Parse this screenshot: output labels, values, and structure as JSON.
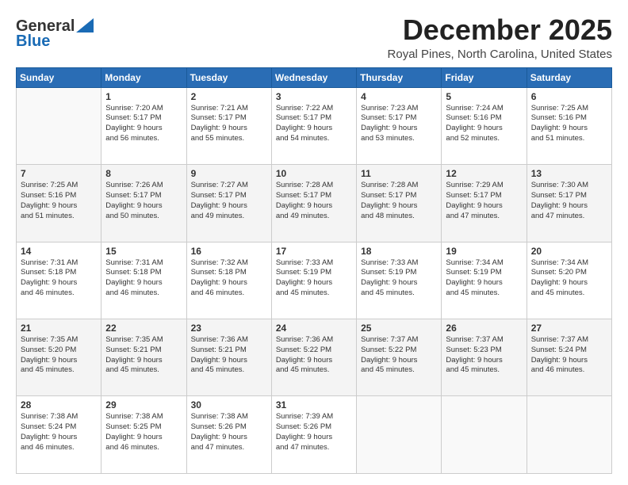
{
  "header": {
    "logo_general": "General",
    "logo_blue": "Blue",
    "month_year": "December 2025",
    "location": "Royal Pines, North Carolina, United States"
  },
  "days_of_week": [
    "Sunday",
    "Monday",
    "Tuesday",
    "Wednesday",
    "Thursday",
    "Friday",
    "Saturday"
  ],
  "weeks": [
    [
      {
        "day": "",
        "info": ""
      },
      {
        "day": "1",
        "info": "Sunrise: 7:20 AM\nSunset: 5:17 PM\nDaylight: 9 hours\nand 56 minutes."
      },
      {
        "day": "2",
        "info": "Sunrise: 7:21 AM\nSunset: 5:17 PM\nDaylight: 9 hours\nand 55 minutes."
      },
      {
        "day": "3",
        "info": "Sunrise: 7:22 AM\nSunset: 5:17 PM\nDaylight: 9 hours\nand 54 minutes."
      },
      {
        "day": "4",
        "info": "Sunrise: 7:23 AM\nSunset: 5:17 PM\nDaylight: 9 hours\nand 53 minutes."
      },
      {
        "day": "5",
        "info": "Sunrise: 7:24 AM\nSunset: 5:16 PM\nDaylight: 9 hours\nand 52 minutes."
      },
      {
        "day": "6",
        "info": "Sunrise: 7:25 AM\nSunset: 5:16 PM\nDaylight: 9 hours\nand 51 minutes."
      }
    ],
    [
      {
        "day": "7",
        "info": "Sunrise: 7:25 AM\nSunset: 5:16 PM\nDaylight: 9 hours\nand 51 minutes."
      },
      {
        "day": "8",
        "info": "Sunrise: 7:26 AM\nSunset: 5:17 PM\nDaylight: 9 hours\nand 50 minutes."
      },
      {
        "day": "9",
        "info": "Sunrise: 7:27 AM\nSunset: 5:17 PM\nDaylight: 9 hours\nand 49 minutes."
      },
      {
        "day": "10",
        "info": "Sunrise: 7:28 AM\nSunset: 5:17 PM\nDaylight: 9 hours\nand 49 minutes."
      },
      {
        "day": "11",
        "info": "Sunrise: 7:28 AM\nSunset: 5:17 PM\nDaylight: 9 hours\nand 48 minutes."
      },
      {
        "day": "12",
        "info": "Sunrise: 7:29 AM\nSunset: 5:17 PM\nDaylight: 9 hours\nand 47 minutes."
      },
      {
        "day": "13",
        "info": "Sunrise: 7:30 AM\nSunset: 5:17 PM\nDaylight: 9 hours\nand 47 minutes."
      }
    ],
    [
      {
        "day": "14",
        "info": "Sunrise: 7:31 AM\nSunset: 5:18 PM\nDaylight: 9 hours\nand 46 minutes."
      },
      {
        "day": "15",
        "info": "Sunrise: 7:31 AM\nSunset: 5:18 PM\nDaylight: 9 hours\nand 46 minutes."
      },
      {
        "day": "16",
        "info": "Sunrise: 7:32 AM\nSunset: 5:18 PM\nDaylight: 9 hours\nand 46 minutes."
      },
      {
        "day": "17",
        "info": "Sunrise: 7:33 AM\nSunset: 5:19 PM\nDaylight: 9 hours\nand 45 minutes."
      },
      {
        "day": "18",
        "info": "Sunrise: 7:33 AM\nSunset: 5:19 PM\nDaylight: 9 hours\nand 45 minutes."
      },
      {
        "day": "19",
        "info": "Sunrise: 7:34 AM\nSunset: 5:19 PM\nDaylight: 9 hours\nand 45 minutes."
      },
      {
        "day": "20",
        "info": "Sunrise: 7:34 AM\nSunset: 5:20 PM\nDaylight: 9 hours\nand 45 minutes."
      }
    ],
    [
      {
        "day": "21",
        "info": "Sunrise: 7:35 AM\nSunset: 5:20 PM\nDaylight: 9 hours\nand 45 minutes."
      },
      {
        "day": "22",
        "info": "Sunrise: 7:35 AM\nSunset: 5:21 PM\nDaylight: 9 hours\nand 45 minutes."
      },
      {
        "day": "23",
        "info": "Sunrise: 7:36 AM\nSunset: 5:21 PM\nDaylight: 9 hours\nand 45 minutes."
      },
      {
        "day": "24",
        "info": "Sunrise: 7:36 AM\nSunset: 5:22 PM\nDaylight: 9 hours\nand 45 minutes."
      },
      {
        "day": "25",
        "info": "Sunrise: 7:37 AM\nSunset: 5:22 PM\nDaylight: 9 hours\nand 45 minutes."
      },
      {
        "day": "26",
        "info": "Sunrise: 7:37 AM\nSunset: 5:23 PM\nDaylight: 9 hours\nand 45 minutes."
      },
      {
        "day": "27",
        "info": "Sunrise: 7:37 AM\nSunset: 5:24 PM\nDaylight: 9 hours\nand 46 minutes."
      }
    ],
    [
      {
        "day": "28",
        "info": "Sunrise: 7:38 AM\nSunset: 5:24 PM\nDaylight: 9 hours\nand 46 minutes."
      },
      {
        "day": "29",
        "info": "Sunrise: 7:38 AM\nSunset: 5:25 PM\nDaylight: 9 hours\nand 46 minutes."
      },
      {
        "day": "30",
        "info": "Sunrise: 7:38 AM\nSunset: 5:26 PM\nDaylight: 9 hours\nand 47 minutes."
      },
      {
        "day": "31",
        "info": "Sunrise: 7:39 AM\nSunset: 5:26 PM\nDaylight: 9 hours\nand 47 minutes."
      },
      {
        "day": "",
        "info": ""
      },
      {
        "day": "",
        "info": ""
      },
      {
        "day": "",
        "info": ""
      }
    ]
  ]
}
